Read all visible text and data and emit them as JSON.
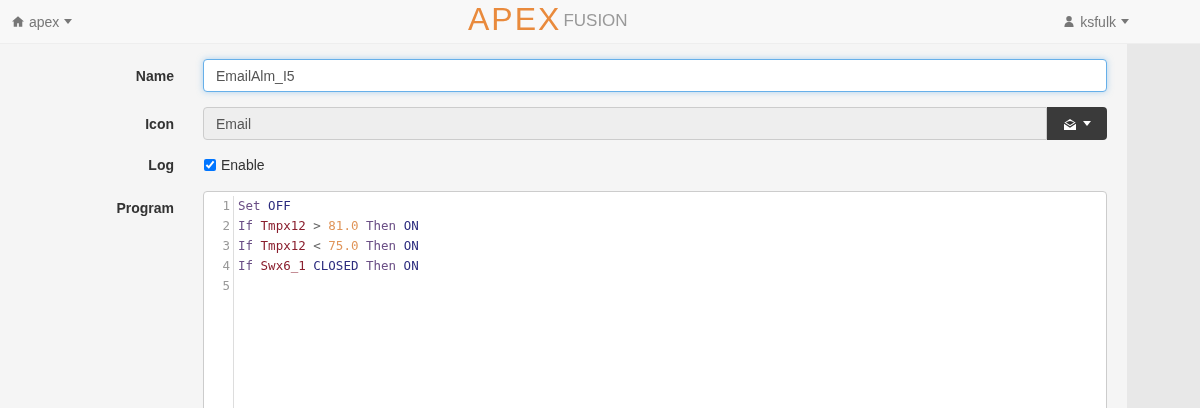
{
  "navbar": {
    "brand": "apex",
    "logo_main": "APEX",
    "logo_sub": "FUSION",
    "user": "ksfulk"
  },
  "form": {
    "name": {
      "label": "Name",
      "value": "EmailAlm_I5"
    },
    "icon": {
      "label": "Icon",
      "value": "Email",
      "disabled": true
    },
    "log": {
      "label": "Log",
      "option": "Enable",
      "checked": true
    },
    "program": {
      "label": "Program",
      "lines": [
        {
          "number": "1",
          "tokens": [
            {
              "text": "Set",
              "kind": "keyword"
            },
            {
              "text": "OFF",
              "kind": "constant"
            }
          ]
        },
        {
          "number": "2",
          "tokens": [
            {
              "text": "If",
              "kind": "keyword"
            },
            {
              "text": "Tmpx12",
              "kind": "variable"
            },
            {
              "text": ">",
              "kind": "operator"
            },
            {
              "text": "81.0",
              "kind": "number"
            },
            {
              "text": "Then",
              "kind": "keyword"
            },
            {
              "text": "ON",
              "kind": "constant"
            }
          ]
        },
        {
          "number": "3",
          "tokens": [
            {
              "text": "If",
              "kind": "keyword"
            },
            {
              "text": "Tmpx12",
              "kind": "variable"
            },
            {
              "text": "<",
              "kind": "operator"
            },
            {
              "text": "75.0",
              "kind": "number"
            },
            {
              "text": "Then",
              "kind": "keyword"
            },
            {
              "text": "ON",
              "kind": "constant"
            }
          ]
        },
        {
          "number": "4",
          "tokens": [
            {
              "text": "If",
              "kind": "keyword"
            },
            {
              "text": "Swx6_1",
              "kind": "variable"
            },
            {
              "text": "CLOSED",
              "kind": "constant"
            },
            {
              "text": "Then",
              "kind": "keyword"
            },
            {
              "text": "ON",
              "kind": "constant"
            }
          ]
        },
        {
          "number": "5"
        }
      ]
    }
  }
}
